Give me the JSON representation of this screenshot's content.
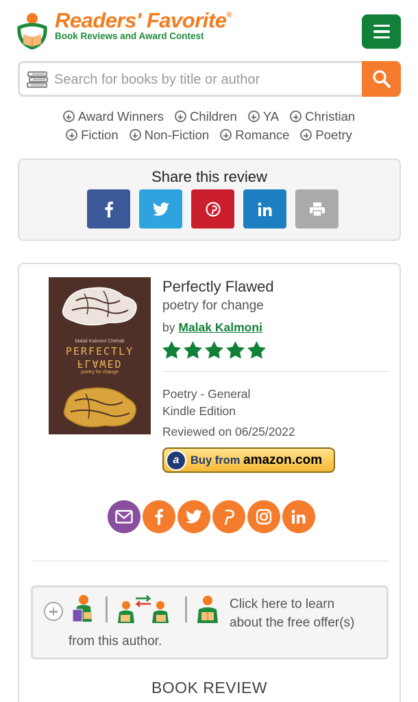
{
  "header": {
    "logo_title": "Readers' Favorite",
    "logo_reg": "®",
    "logo_subtitle": "Book Reviews and Award Contest",
    "menu_icon": "hamburger-icon",
    "brand_orange": "#f47c20",
    "brand_green": "#11813a"
  },
  "search": {
    "placeholder": "Search for books by title or author",
    "value": "",
    "button_icon": "search-icon"
  },
  "categories": {
    "row1": [
      "Award Winners",
      "Children",
      "YA",
      "Christian"
    ],
    "row2": [
      "Fiction",
      "Non-Fiction",
      "Romance",
      "Poetry"
    ]
  },
  "share": {
    "title": "Share this review",
    "buttons": [
      {
        "name": "facebook",
        "glyph": "f",
        "color": "#3b5998"
      },
      {
        "name": "twitter",
        "glyph": "twitter-bird",
        "color": "#2ea3de"
      },
      {
        "name": "pinterest",
        "glyph": "pinterest-p",
        "color": "#cc1f2e"
      },
      {
        "name": "linkedin",
        "glyph": "in",
        "color": "#1d7ec2"
      },
      {
        "name": "print",
        "glyph": "printer",
        "color": "#aaaaaa"
      }
    ]
  },
  "book": {
    "cover": {
      "author": "Malak Kalmoni Chehab",
      "title_line1": "PERFECTLY",
      "title_line2": "FLAWED",
      "subtitle": "poetry for change"
    },
    "title": "Perfectly Flawed",
    "subtitle": "poetry for change",
    "by_label": "by",
    "author": "Malak Kalmoni",
    "rating": 5,
    "genre": "Poetry - General",
    "edition": "Kindle Edition",
    "reviewed_on": "Reviewed on 06/25/2022",
    "amazon_label": "Buy from",
    "amazon_brand": "amazon.com"
  },
  "social": [
    {
      "name": "email",
      "glyph": "envelope"
    },
    {
      "name": "facebook",
      "glyph": "f"
    },
    {
      "name": "twitter",
      "glyph": "twitter-bird"
    },
    {
      "name": "pinterest",
      "glyph": "p"
    },
    {
      "name": "instagram",
      "glyph": "camera"
    },
    {
      "name": "linkedin",
      "glyph": "in"
    }
  ],
  "offer": {
    "line1": "Click here to learn",
    "line2": "about the free offer(s)",
    "line3": "from this author."
  },
  "review_heading": "BOOK REVIEW"
}
